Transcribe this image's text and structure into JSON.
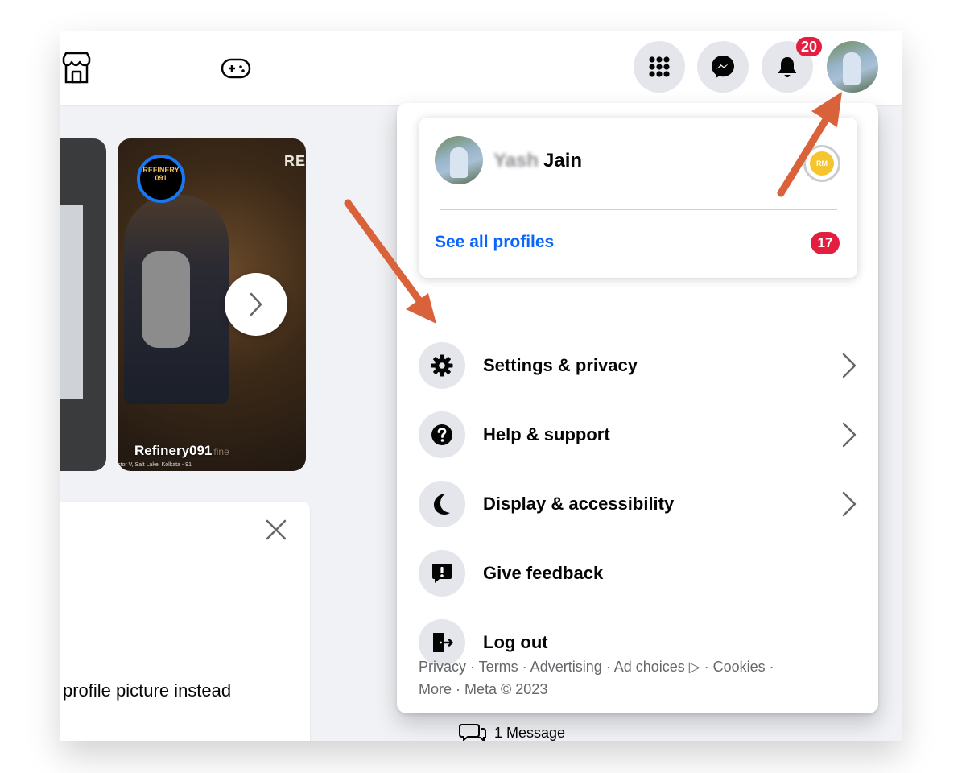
{
  "topbar": {
    "left_icons": [
      "marketplace-icon",
      "gaming-icon"
    ],
    "right_buttons": [
      "menu-grid-icon",
      "messenger-icon",
      "bell-icon"
    ],
    "notification_count": "20"
  },
  "stories": {
    "story_name": "Refinery091",
    "story_ring_text": "REFINERY 091",
    "story_corner_text": "RE",
    "story_tiny_text": "ctor V, Salt Lake, Kolkata - 91",
    "story_faded_text": "fine"
  },
  "card": {
    "text": "profile picture instead"
  },
  "message_line": "1 Message",
  "menu": {
    "profile_name_blurred": "Yash",
    "profile_name": "Jain",
    "switch_badge": "RM",
    "see_all_label": "See all profiles",
    "see_all_count": "17",
    "items": [
      {
        "label": "Settings & privacy",
        "icon": "gear-icon",
        "has_chevron": true
      },
      {
        "label": "Help & support",
        "icon": "question-icon",
        "has_chevron": true
      },
      {
        "label": "Display & accessibility",
        "icon": "moon-icon",
        "has_chevron": true
      },
      {
        "label": "Give feedback",
        "icon": "feedback-icon",
        "has_chevron": false
      },
      {
        "label": "Log out",
        "icon": "logout-icon",
        "has_chevron": false
      }
    ],
    "footer_line1": "Privacy · Terms · Advertising · Ad choices ▷ · Cookies ·",
    "footer_line2": "More · Meta © 2023"
  },
  "annotation_color": "#d9623b"
}
